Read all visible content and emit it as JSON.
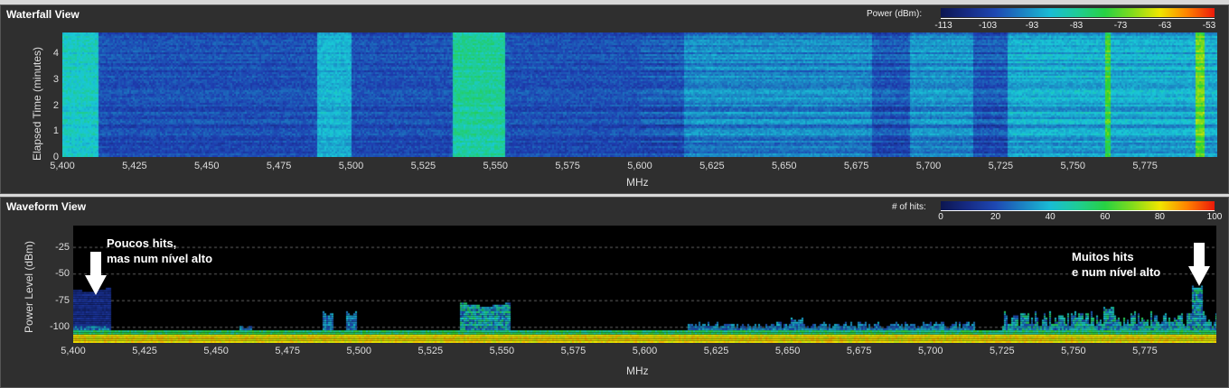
{
  "waterfall": {
    "title": "Waterfall View",
    "legend_label": "Power (dBm):",
    "legend_ticks": [
      "-113",
      "-103",
      "-93",
      "-83",
      "-73",
      "-63",
      "-53"
    ],
    "accent_colors": [
      "#0b1a5c",
      "#1f3fb0",
      "#19c8d8",
      "#2ed12e",
      "#f2e600",
      "#ff7a00",
      "#ee1c0c"
    ]
  },
  "waveform": {
    "title": "Waveform View",
    "legend_label": "# of hits:",
    "legend_ticks": [
      "0",
      "20",
      "40",
      "60",
      "80",
      "100"
    ],
    "annotation_left": [
      "Poucos hits,",
      "mas num nível alto"
    ],
    "annotation_right": [
      "Muitos hits",
      "e num nível alto"
    ]
  },
  "chart_data": [
    {
      "type": "heatmap",
      "title": "Waterfall View",
      "xlabel": "MHz",
      "ylabel": "Elapsed Time (minutes)",
      "xlim": [
        5400,
        5800
      ],
      "ylim": [
        0,
        4.8
      ],
      "x_ticks": [
        "5,400",
        "5,425",
        "5,450",
        "5,475",
        "5,500",
        "5,525",
        "5,550",
        "5,575",
        "5,600",
        "5,625",
        "5,650",
        "5,675",
        "5,700",
        "5,725",
        "5,750",
        "5,775"
      ],
      "y_ticks": [
        "0",
        "1",
        "2",
        "3",
        "4"
      ],
      "colorbar": {
        "label": "Power (dBm)",
        "range": [
          -118,
          -48
        ]
      },
      "bands_dbm": [
        {
          "from": 5400,
          "to": 5412,
          "level": -88
        },
        {
          "from": 5488,
          "to": 5500,
          "level": -92
        },
        {
          "from": 5535,
          "to": 5553,
          "level": -84
        },
        {
          "from": 5615,
          "to": 5680,
          "level": -98
        },
        {
          "from": 5693,
          "to": 5715,
          "level": -97
        },
        {
          "from": 5727,
          "to": 5800,
          "level": -94
        },
        {
          "from": 5761,
          "to": 5763,
          "level": -76
        },
        {
          "from": 5792,
          "to": 5795,
          "level": -72
        }
      ]
    },
    {
      "type": "heatmap",
      "title": "Waveform View",
      "xlabel": "MHz",
      "ylabel": "Power Level (dBm)",
      "xlim": [
        5400,
        5800
      ],
      "ylim": [
        -115,
        -5
      ],
      "x_ticks": [
        "5,400",
        "5,425",
        "5,450",
        "5,475",
        "5,500",
        "5,525",
        "5,550",
        "5,575",
        "5,600",
        "5,625",
        "5,650",
        "5,675",
        "5,700",
        "5,725",
        "5,750",
        "5,775"
      ],
      "y_ticks": [
        "-25",
        "-50",
        "-75",
        "-100"
      ],
      "grid": true,
      "colorbar": {
        "label": "# of hits",
        "range": [
          0,
          100
        ]
      },
      "noise_floor_dbm": -108,
      "peaks_dbm": [
        {
          "freq": 5405,
          "level": -68
        },
        {
          "freq": 5460,
          "level": -103
        },
        {
          "freq": 5489,
          "level": -90
        },
        {
          "freq": 5497,
          "level": -90
        },
        {
          "freq": 5544,
          "level": -82
        },
        {
          "freq": 5653,
          "level": -96
        },
        {
          "freq": 5762,
          "level": -85
        },
        {
          "freq": 5793,
          "level": -65
        }
      ]
    }
  ]
}
